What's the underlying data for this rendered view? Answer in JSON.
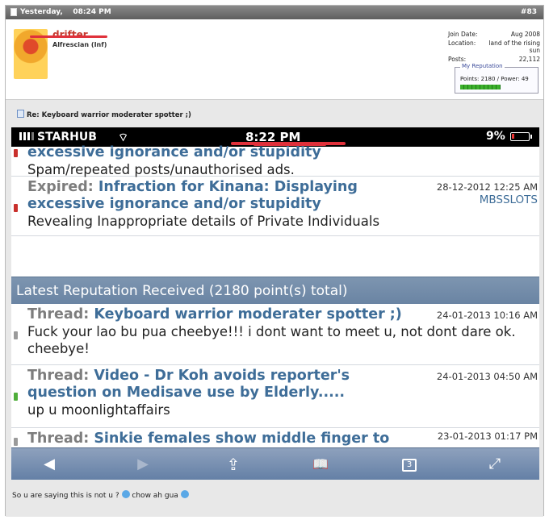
{
  "post": {
    "date": "Yesterday,",
    "time": "08:24 PM",
    "number": "#83"
  },
  "user": {
    "name": "drifter",
    "title": "Alfrescian (Inf)",
    "info": [
      {
        "label": "Join Date:",
        "value": "Aug 2008"
      },
      {
        "label": "Location:",
        "value": "land of the rising sun"
      },
      {
        "label": "Posts:",
        "value": "22,112"
      }
    ],
    "reputation_legend": "My Reputation",
    "reputation_text": "Points: 2180 / Power: 49"
  },
  "post_title": "Re: Keyboard warrior moderater spotter ;)",
  "phone": {
    "carrier": "STARHUB",
    "time": "8:22 PM",
    "battery": "9%",
    "battery_level": 0.09
  },
  "infractions": [
    {
      "label": "",
      "title": "excessive ignorance and/or stupidity",
      "desc": "Spam/repeated posts/unauthorised ads.",
      "date": "",
      "user": "",
      "bullet_color": "#c9302c"
    },
    {
      "label": "Expired:",
      "title": "Infraction for Kinana: Displaying excessive ignorance and/or stupidity",
      "desc": "Revealing Inappropriate details of Private Individuals",
      "date": "28-12-2012 12:25 AM",
      "user": "MBSSLOTS",
      "bullet_color": "#c9302c"
    }
  ],
  "reputation_header": "Latest Reputation Received (2180 point(s) total)",
  "reputations": [
    {
      "label": "Thread:",
      "title": "Keyboard warrior moderater spotter ;)",
      "desc": "Fuck your lao bu pua cheebye!!! i dont want to meet u, not dont dare ok. cheebye!",
      "date": "24-01-2013 10:16 AM",
      "bullet_color": "#9a9a9a"
    },
    {
      "label": "Thread:",
      "title": "Video - Dr Koh avoids reporter's question on Medisave use by Elderly.....",
      "desc": "up u moonlightaffairs",
      "date": "24-01-2013 04:50 AM",
      "bullet_color": "#4fae3a"
    },
    {
      "label": "Thread:",
      "title": "Sinkie females show middle finger to",
      "desc": "",
      "date": "23-01-2013 01:17 PM",
      "bullet_color": "#9a9a9a"
    }
  ],
  "toolbar": {
    "back": "◀",
    "forward": "▶",
    "share": "⇪",
    "bookmarks": "📖",
    "tabs": "3",
    "fullscreen": "⤢",
    "icons": [
      "back-icon",
      "forward-icon",
      "share-icon",
      "bookmarks-icon",
      "tabs-icon",
      "fullscreen-icon"
    ]
  },
  "caption": "So u are saying this is not u ?",
  "caption_tail": "chow ah gua",
  "colors": {
    "annotation": "#e0313b",
    "link": "#3e6d98",
    "header": "#6a84a3"
  }
}
